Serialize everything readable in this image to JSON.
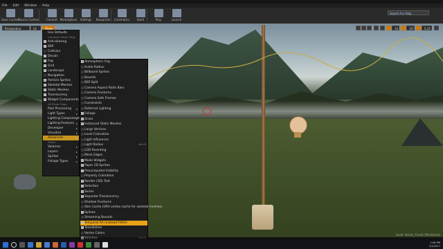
{
  "menubar": {
    "items": [
      "File",
      "Edit",
      "Window",
      "Help"
    ]
  },
  "toolbar": {
    "buttons": [
      {
        "label": "Save Current",
        "icon": "save-icon"
      },
      {
        "label": "Source Control",
        "icon": "source-control-icon"
      },
      {
        "label": "Content",
        "icon": "content-icon"
      },
      {
        "label": "Marketplace",
        "icon": "marketplace-icon"
      },
      {
        "label": "Settings",
        "icon": "gear-icon"
      },
      {
        "label": "Blueprints",
        "icon": "blueprints-icon"
      },
      {
        "label": "Cinematics",
        "icon": "cinematics-icon"
      },
      {
        "label": "Build",
        "icon": "build-icon"
      },
      {
        "label": "Play",
        "icon": "play-icon"
      },
      {
        "label": "Launch",
        "icon": "launch-icon"
      }
    ],
    "search_placeholder": "Search For Help"
  },
  "viewport_toolbar": {
    "perspective": "Perspective",
    "lit": "Lit",
    "show": "Show",
    "grid_value": "10",
    "angle_value": "10°",
    "scale_value": "0.25"
  },
  "show_menu": {
    "items": [
      {
        "type": "item",
        "label": "Use Defaults"
      },
      {
        "type": "header",
        "label": "Common Show Flags"
      },
      {
        "type": "check",
        "label": "Anti-aliasing",
        "checked": true
      },
      {
        "type": "check",
        "label": "BSP",
        "checked": true
      },
      {
        "type": "check",
        "label": "Collision",
        "checked": false
      },
      {
        "type": "check",
        "label": "Decals",
        "checked": true
      },
      {
        "type": "check",
        "label": "Fog",
        "checked": true
      },
      {
        "type": "check",
        "label": "Grid",
        "checked": true
      },
      {
        "type": "check",
        "label": "Landscape",
        "checked": true
      },
      {
        "type": "check",
        "label": "Navigation",
        "checked": false
      },
      {
        "type": "check",
        "label": "Particle Sprites",
        "checked": true
      },
      {
        "type": "check",
        "label": "Skeletal Meshes",
        "checked": true
      },
      {
        "type": "check",
        "label": "Static Meshes",
        "checked": true
      },
      {
        "type": "check",
        "label": "Translucency",
        "checked": true
      },
      {
        "type": "check",
        "label": "Widget Components",
        "checked": true
      },
      {
        "type": "header",
        "label": "All Show Flags"
      },
      {
        "type": "sub",
        "label": "Post Processing"
      },
      {
        "type": "sub",
        "label": "Light Types"
      },
      {
        "type": "sub",
        "label": "Lighting Components"
      },
      {
        "type": "sub",
        "label": "Lighting Features"
      },
      {
        "type": "sub",
        "label": "Developer"
      },
      {
        "type": "sub",
        "label": "Visualize"
      },
      {
        "type": "sub",
        "label": "Advanced",
        "highlighted": true
      },
      {
        "type": "header",
        "label": "Editor"
      },
      {
        "type": "sub",
        "label": "Volumes"
      },
      {
        "type": "sub",
        "label": "Layers"
      },
      {
        "type": "sub",
        "label": "Sprites"
      },
      {
        "type": "sub",
        "label": "Foliage Types"
      }
    ]
  },
  "advanced_menu": {
    "items": [
      {
        "label": "Atmospheric Fog",
        "checked": true
      },
      {
        "label": "Audio Radius",
        "checked": false
      },
      {
        "label": "Billboard Sprites",
        "checked": false
      },
      {
        "label": "Bounds",
        "checked": false
      },
      {
        "label": "BSP Split",
        "checked": false
      },
      {
        "label": "Camera Aspect Ratio Bars",
        "checked": false
      },
      {
        "label": "Camera Frustums",
        "checked": false
      },
      {
        "label": "Camera Safe Frames",
        "checked": false
      },
      {
        "label": "Constraints",
        "checked": false
      },
      {
        "label": "Deferred Lighting",
        "checked": false
      },
      {
        "label": "Foliage",
        "checked": true
      },
      {
        "label": "Grass",
        "checked": true
      },
      {
        "label": "Instanced Static Meshes",
        "checked": true
      },
      {
        "label": "Large Vertices",
        "checked": false
      },
      {
        "label": "Level Coloration",
        "checked": false
      },
      {
        "label": "Light Influences",
        "checked": false
      },
      {
        "label": "Light Radius",
        "checked": false,
        "shortcut": "Alt+R"
      },
      {
        "label": "LOD Parenting",
        "checked": false
      },
      {
        "label": "Mesh Edges",
        "checked": false
      },
      {
        "label": "Mode Widgets",
        "checked": true
      },
      {
        "label": "Paper 2D Sprites",
        "checked": true
      },
      {
        "label": "Precomputed Visibility",
        "checked": true
      },
      {
        "label": "Property Coloration",
        "checked": false
      },
      {
        "label": "Render (3D) Text",
        "checked": true
      },
      {
        "label": "Selection",
        "checked": true
      },
      {
        "label": "Series",
        "checked": true
      },
      {
        "label": "Separate Translucency",
        "checked": true
      },
      {
        "label": "Shadow Frustums",
        "checked": false
      },
      {
        "label": "Skin Cache (GPU vertex cache for skeletal meshes)",
        "checked": false
      },
      {
        "label": "Splines",
        "checked": true
      },
      {
        "label": "Streaming Bounds",
        "checked": false
      },
      {
        "label": "Temporal AA (instead FXAA)",
        "checked": true,
        "selected": true
      },
      {
        "label": "Tessellation",
        "checked": true
      },
      {
        "label": "Vertex Colors",
        "checked": false
      },
      {
        "label": "Volumes",
        "checked": true,
        "shortcut": "Alt+O"
      }
    ]
  },
  "status": {
    "level": "Level: Vector_Forest (Persistent)"
  },
  "taskbar": {
    "time": "1:56 PM",
    "date": "2/1/2017"
  }
}
